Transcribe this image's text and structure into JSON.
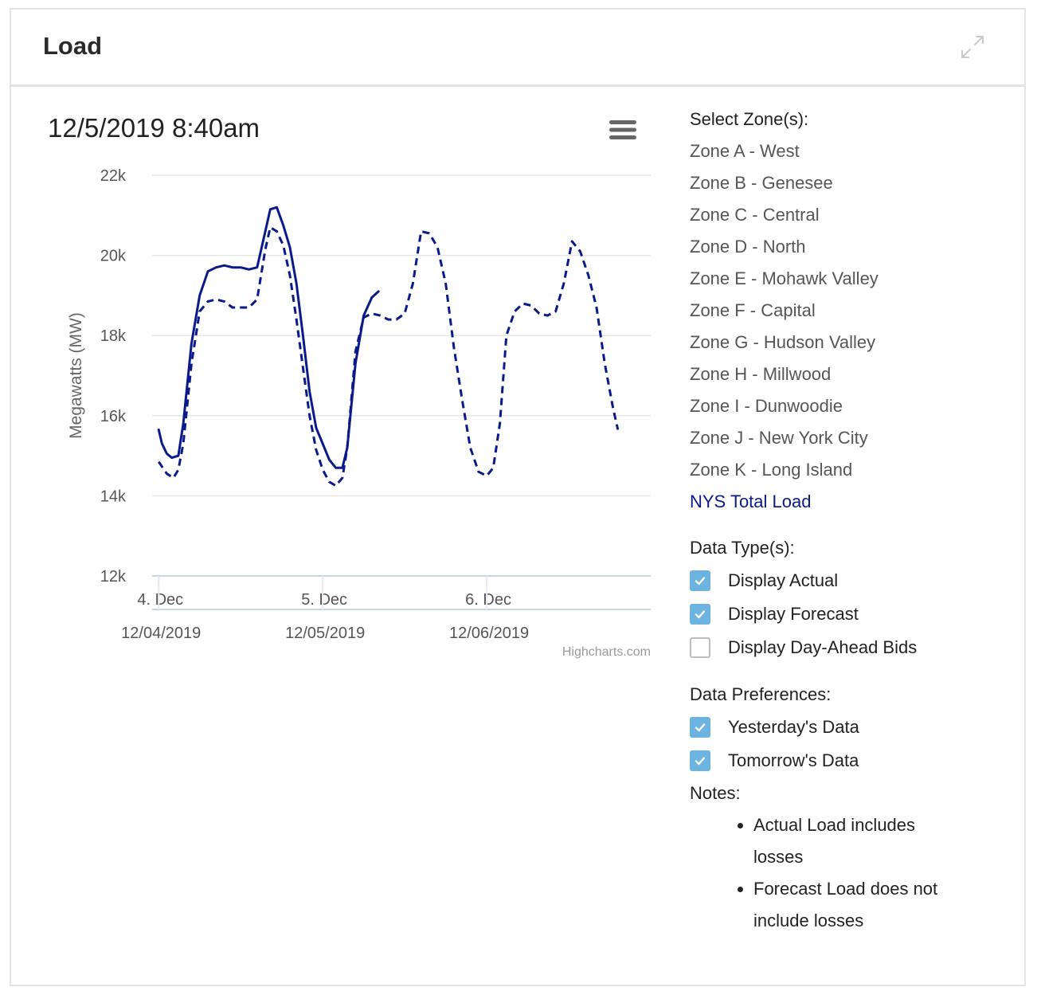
{
  "panel": {
    "title": "Load"
  },
  "chart": {
    "title": "12/5/2019 8:40am",
    "credit": "Highcharts.com"
  },
  "chart_data": {
    "type": "line",
    "title": "12/5/2019 8:40am",
    "ylabel": "Megawatts (MW)",
    "xlabel": "",
    "ylim": [
      12000,
      22000
    ],
    "yticks": [
      "22k",
      "20k",
      "18k",
      "16k",
      "14k",
      "12k"
    ],
    "ytick_values": [
      22000,
      20000,
      18000,
      16000,
      14000,
      12000
    ],
    "xlim": [
      -0.04,
      3.0
    ],
    "xticks": [
      {
        "t": 0,
        "label": "4. Dec"
      },
      {
        "t": 1,
        "label": "5. Dec"
      },
      {
        "t": 2,
        "label": "6. Dec"
      }
    ],
    "navigator_labels": [
      {
        "t": 0,
        "label": "12/04/2019"
      },
      {
        "t": 1,
        "label": "12/05/2019"
      },
      {
        "t": 2,
        "label": "12/06/2019"
      }
    ],
    "grid": true,
    "series": [
      {
        "style": "solid",
        "color": "#0b1a8a",
        "points": [
          [
            0.0,
            15650
          ],
          [
            0.02,
            15300
          ],
          [
            0.05,
            15050
          ],
          [
            0.08,
            14950
          ],
          [
            0.12,
            15000
          ],
          [
            0.15,
            15800
          ],
          [
            0.2,
            17800
          ],
          [
            0.25,
            19000
          ],
          [
            0.3,
            19600
          ],
          [
            0.35,
            19700
          ],
          [
            0.4,
            19750
          ],
          [
            0.45,
            19700
          ],
          [
            0.5,
            19700
          ],
          [
            0.55,
            19650
          ],
          [
            0.6,
            19700
          ],
          [
            0.65,
            20600
          ],
          [
            0.68,
            21150
          ],
          [
            0.72,
            21200
          ],
          [
            0.76,
            20750
          ],
          [
            0.8,
            20200
          ],
          [
            0.84,
            19300
          ],
          [
            0.88,
            18000
          ],
          [
            0.92,
            16600
          ],
          [
            0.96,
            15700
          ],
          [
            1.0,
            15300
          ],
          [
            1.04,
            14900
          ],
          [
            1.08,
            14700
          ],
          [
            1.12,
            14700
          ],
          [
            1.15,
            15200
          ],
          [
            1.2,
            17300
          ],
          [
            1.25,
            18500
          ],
          [
            1.3,
            18950
          ],
          [
            1.34,
            19100
          ]
        ]
      },
      {
        "style": "dashed",
        "color": "#0b1a8a",
        "points": [
          [
            0.0,
            14850
          ],
          [
            0.05,
            14550
          ],
          [
            0.09,
            14450
          ],
          [
            0.12,
            14650
          ],
          [
            0.15,
            15300
          ],
          [
            0.2,
            17300
          ],
          [
            0.25,
            18600
          ],
          [
            0.3,
            18850
          ],
          [
            0.35,
            18900
          ],
          [
            0.4,
            18850
          ],
          [
            0.45,
            18700
          ],
          [
            0.5,
            18700
          ],
          [
            0.55,
            18700
          ],
          [
            0.6,
            18900
          ],
          [
            0.65,
            20150
          ],
          [
            0.68,
            20700
          ],
          [
            0.72,
            20600
          ],
          [
            0.76,
            20250
          ],
          [
            0.8,
            19500
          ],
          [
            0.84,
            18400
          ],
          [
            0.88,
            17200
          ],
          [
            0.92,
            16000
          ],
          [
            0.96,
            15150
          ],
          [
            1.0,
            14650
          ],
          [
            1.04,
            14350
          ],
          [
            1.08,
            14250
          ],
          [
            1.12,
            14450
          ],
          [
            1.15,
            15200
          ],
          [
            1.2,
            17600
          ],
          [
            1.25,
            18450
          ],
          [
            1.3,
            18550
          ],
          [
            1.35,
            18500
          ],
          [
            1.4,
            18400
          ],
          [
            1.45,
            18400
          ],
          [
            1.5,
            18550
          ],
          [
            1.55,
            19300
          ],
          [
            1.6,
            20600
          ],
          [
            1.65,
            20550
          ],
          [
            1.7,
            20200
          ],
          [
            1.75,
            19300
          ],
          [
            1.8,
            17700
          ],
          [
            1.85,
            16400
          ],
          [
            1.9,
            15200
          ],
          [
            1.95,
            14600
          ],
          [
            2.0,
            14500
          ],
          [
            2.04,
            14700
          ],
          [
            2.08,
            15800
          ],
          [
            2.12,
            18000
          ],
          [
            2.17,
            18600
          ],
          [
            2.22,
            18800
          ],
          [
            2.27,
            18750
          ],
          [
            2.32,
            18550
          ],
          [
            2.37,
            18500
          ],
          [
            2.42,
            18600
          ],
          [
            2.47,
            19300
          ],
          [
            2.52,
            20350
          ],
          [
            2.57,
            20100
          ],
          [
            2.62,
            19500
          ],
          [
            2.67,
            18700
          ],
          [
            2.72,
            17300
          ],
          [
            2.77,
            16200
          ],
          [
            2.8,
            15650
          ]
        ]
      }
    ]
  },
  "sidebar": {
    "zones_label": "Select Zone(s):",
    "zones": [
      "Zone A - West",
      "Zone B - Genesee",
      "Zone C - Central",
      "Zone D - North",
      "Zone E - Mohawk Valley",
      "Zone F - Capital",
      "Zone G - Hudson Valley",
      "Zone H - Millwood",
      "Zone I - Dunwoodie",
      "Zone J - New York City",
      "Zone K - Long Island",
      "NYS Total Load"
    ],
    "active_zone": "NYS Total Load",
    "data_types_label": "Data Type(s):",
    "data_types": [
      {
        "label": "Display Actual",
        "checked": true
      },
      {
        "label": "Display Forecast",
        "checked": true
      },
      {
        "label": "Display Day-Ahead Bids",
        "checked": false
      }
    ],
    "prefs_label": "Data Preferences:",
    "prefs": [
      {
        "label": "Yesterday's Data",
        "checked": true
      },
      {
        "label": "Tomorrow's Data",
        "checked": true
      }
    ],
    "notes_label": "Notes:",
    "notes": [
      "Actual Load includes losses",
      "Forecast Load does not include losses"
    ]
  },
  "colors": {
    "series": "#0b1a8a",
    "checkbox_on": "#6cb3df",
    "active_zone": "#0b1a8a",
    "grid": "#e6e6e6"
  },
  "icons": {
    "expand": "expand-icon",
    "menu": "hamburger-menu-icon",
    "check": "check-icon"
  }
}
